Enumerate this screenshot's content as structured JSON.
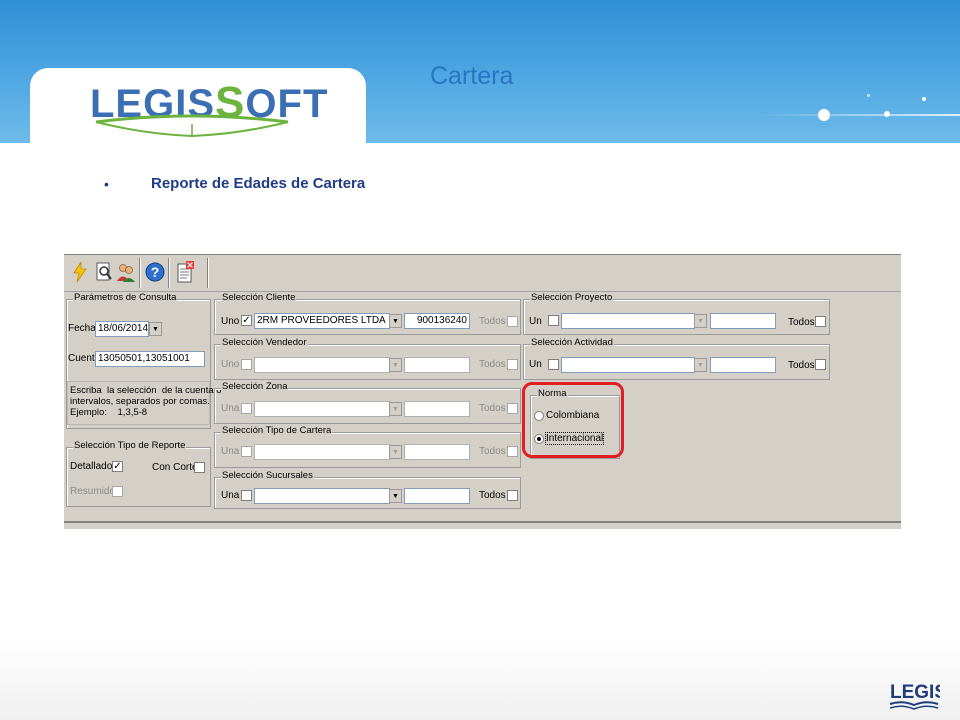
{
  "slide": {
    "title": "Cartera",
    "bullet": "Reporte de Edades de Cartera",
    "logo_left": "LEGIS",
    "logo_s": "S",
    "logo_right": "FT",
    "footer_logo": "LEGIS"
  },
  "toolbar": {
    "buttons": [
      "lightning-icon",
      "preview-icon",
      "users-icon",
      "help-icon",
      "close-report-icon"
    ]
  },
  "parametros": {
    "legend": "Parámetros de Consulta",
    "fecha_label": "Fecha",
    "fecha_value": "18/06/2014",
    "cuenta_label": "Cuenta",
    "cuenta_value": "13050501,13051001",
    "help": "Escriba  la selección  de la cuenta o\nintervalos, separados por comas.\nEjemplo:    1,3,5-8"
  },
  "tipo_reporte": {
    "legend": "Selección Tipo de Reporte",
    "detallado": "Detallado",
    "con_corte": "Con Corte",
    "resumido": "Resumido"
  },
  "cliente": {
    "legend": "Selección Cliente",
    "uno": "Uno",
    "value": "2RM PROVEEDORES LTDA",
    "code": "900136240",
    "todos": "Todos"
  },
  "vendedor": {
    "legend": "Selección Vendedor",
    "uno": "Uno",
    "todos": "Todos"
  },
  "zona": {
    "legend": "Selección Zona",
    "una": "Una",
    "todos": "Todos"
  },
  "tipo_cartera": {
    "legend": "Selección Tipo de Cartera",
    "una": "Una",
    "todos": "Todos"
  },
  "sucursales": {
    "legend": "Selección Sucursales",
    "una": "Una",
    "todos": "Todos"
  },
  "proyecto": {
    "legend": "Selección Proyecto",
    "un": "Un",
    "todos": "Todos"
  },
  "actividad": {
    "legend": "Selección Actividad",
    "un": "Un",
    "todos": "Todos"
  },
  "norma": {
    "legend": "Norma",
    "colombiana": "Colombiana",
    "internacional": "Internacional",
    "selected": "Internacional"
  },
  "colors": {
    "highlight": "#e01e24",
    "title": "#2b74c3",
    "bullet": "#1f3c88"
  }
}
